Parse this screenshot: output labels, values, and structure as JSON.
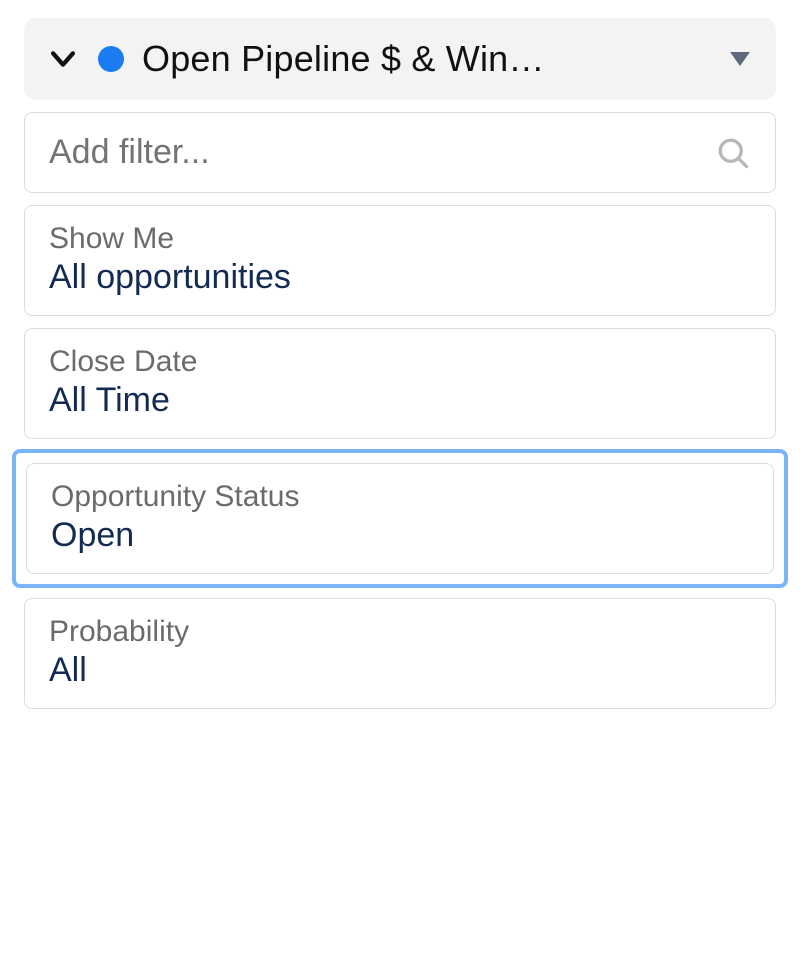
{
  "header": {
    "title": "Open Pipeline $ & Win…",
    "status_color": "#1b7bf0"
  },
  "add_filter": {
    "placeholder": "Add filter..."
  },
  "filters": [
    {
      "label": "Show Me",
      "value": "All opportunities",
      "selected": false
    },
    {
      "label": "Close Date",
      "value": "All Time",
      "selected": false
    },
    {
      "label": "Opportunity Status",
      "value": "Open",
      "selected": true
    },
    {
      "label": "Probability",
      "value": "All",
      "selected": false
    }
  ]
}
